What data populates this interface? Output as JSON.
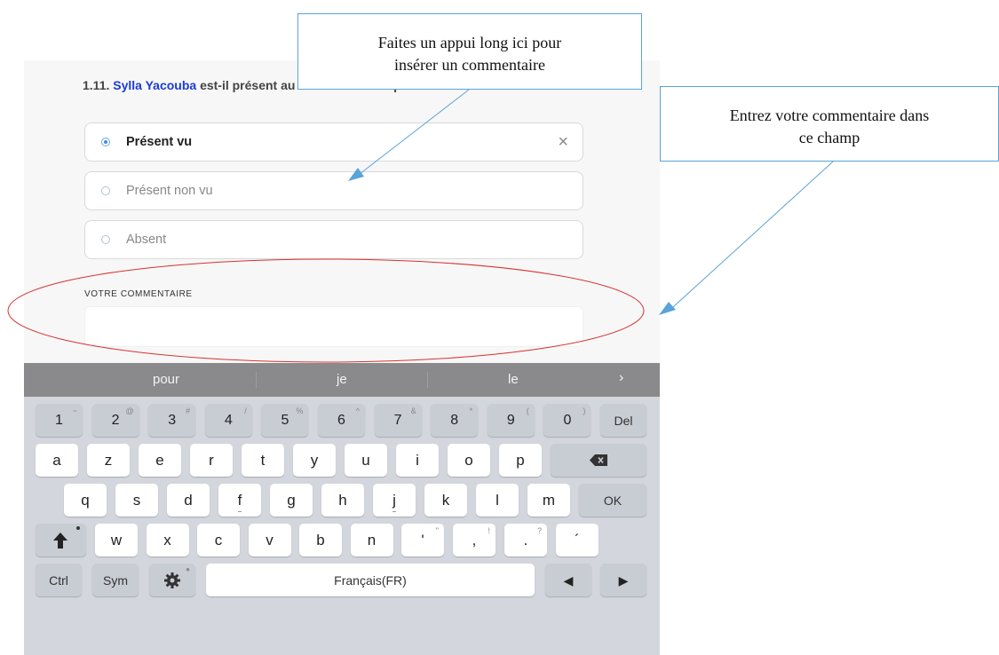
{
  "question": {
    "number": "1.11.",
    "name": "Sylla Yacouba",
    "text": "est-il présent au moment de l'enquête?"
  },
  "options": [
    {
      "label": "Présent vu",
      "selected": true
    },
    {
      "label": "Présent non vu",
      "selected": false
    },
    {
      "label": "Absent",
      "selected": false
    }
  ],
  "clear_icon": "×",
  "comment": {
    "label": "VOTRE COMMENTAIRE",
    "value": ""
  },
  "suggestions": {
    "words": [
      "pour",
      "je",
      "le"
    ],
    "more": "›"
  },
  "keyboard": {
    "row1": [
      [
        "1",
        "~"
      ],
      [
        "2",
        "@"
      ],
      [
        "3",
        "#"
      ],
      [
        "4",
        "/"
      ],
      [
        "5",
        "%"
      ],
      [
        "6",
        "^"
      ],
      [
        "7",
        "&"
      ],
      [
        "8",
        "*"
      ],
      [
        "9",
        "("
      ],
      [
        "0",
        ")"
      ]
    ],
    "del": "Del",
    "row2": [
      "a",
      "z",
      "e",
      "r",
      "t",
      "y",
      "u",
      "i",
      "o",
      "p"
    ],
    "backspace_icon": "backspace-icon",
    "row3": [
      "q",
      "s",
      "d",
      "f",
      "g",
      "h",
      "j",
      "k",
      "l",
      "m"
    ],
    "ok": "OK",
    "shift_icon": "shift-icon",
    "row4": [
      "w",
      "x",
      "c",
      "v",
      "b",
      "n"
    ],
    "punct": [
      [
        "'",
        "\""
      ],
      [
        ",",
        "!"
      ],
      [
        ".",
        "?"
      ],
      [
        "´",
        ""
      ]
    ],
    "ctrl": "Ctrl",
    "sym": "Sym",
    "settings_icon": "gear-icon",
    "space": "Français(FR)",
    "left_icon": "◀",
    "right_icon": "▶"
  },
  "annotations": {
    "callout1": {
      "line1": "Faites un appui long ici pour",
      "line2": "insérer un commentaire"
    },
    "callout2": {
      "line1": "Entrez votre commentaire dans",
      "line2": "ce champ"
    }
  },
  "colors": {
    "name_blue": "#1a3bd6",
    "annotation_blue": "#5aa3d9",
    "ellipse_red": "#d93030"
  }
}
